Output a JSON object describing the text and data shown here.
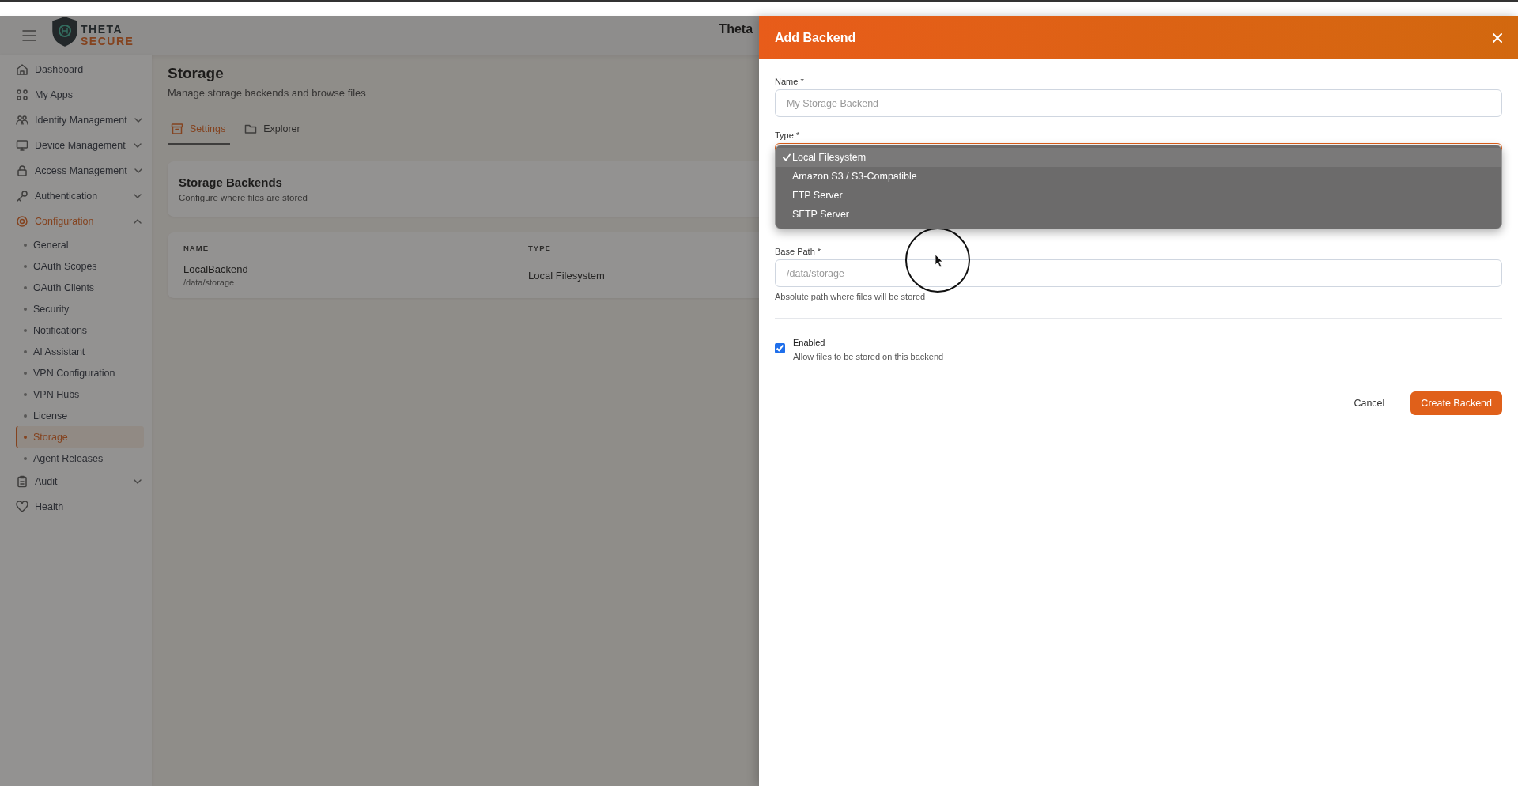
{
  "header": {
    "logo_lines": [
      "THETA",
      "SECURE"
    ],
    "title": "Theta"
  },
  "sidebar": {
    "items": [
      {
        "label": "Dashboard",
        "selected": false
      },
      {
        "label": "My Apps",
        "selected": false
      },
      {
        "label": "Identity Management",
        "selected": false,
        "expanded": false
      },
      {
        "label": "Device Management",
        "selected": false,
        "expanded": false
      },
      {
        "label": "Access Management",
        "selected": false,
        "expanded": false
      },
      {
        "label": "Authentication",
        "selected": false,
        "expanded": false
      },
      {
        "label": "Configuration",
        "selected": true,
        "expanded": true,
        "children": [
          {
            "label": "General",
            "selected": false
          },
          {
            "label": "OAuth Scopes",
            "selected": false
          },
          {
            "label": "OAuth Clients",
            "selected": false
          },
          {
            "label": "Security",
            "selected": false
          },
          {
            "label": "Notifications",
            "selected": false
          },
          {
            "label": "AI Assistant",
            "selected": false
          },
          {
            "label": "VPN Configuration",
            "selected": false
          },
          {
            "label": "VPN Hubs",
            "selected": false
          },
          {
            "label": "License",
            "selected": false
          },
          {
            "label": "Storage",
            "selected": true
          },
          {
            "label": "Agent Releases",
            "selected": false
          }
        ]
      },
      {
        "label": "Audit",
        "selected": false,
        "expanded": false
      },
      {
        "label": "Health",
        "selected": false
      }
    ]
  },
  "page": {
    "title": "Storage",
    "subtitle": "Manage storage backends and browse files",
    "tabs": [
      {
        "label": "Settings",
        "selected": true
      },
      {
        "label": "Explorer",
        "selected": false
      }
    ],
    "card": {
      "title": "Storage Backends",
      "subtitle": "Configure where files are stored"
    },
    "table": {
      "columns": [
        "NAME",
        "TYPE"
      ],
      "rows": [
        {
          "name": "LocalBackend",
          "path": "/data/storage",
          "type": "Local Filesystem"
        }
      ]
    }
  },
  "panel": {
    "title": "Add Backend",
    "name_field": {
      "label": "Name *",
      "placeholder": "My Storage Backend"
    },
    "type_field": {
      "label": "Type *",
      "options": [
        {
          "label": "Local Filesystem",
          "selected": true
        },
        {
          "label": "Amazon S3 / S3-Compatible",
          "selected": false
        },
        {
          "label": "FTP Server",
          "selected": false
        },
        {
          "label": "SFTP Server",
          "selected": false
        }
      ]
    },
    "base_path_field": {
      "label": "Base Path *",
      "placeholder": "/data/storage",
      "hint": "Absolute path where files will be stored"
    },
    "enabled": {
      "label": "Enabled",
      "description": "Allow files to be stored on this backend",
      "checked": true
    },
    "buttons": [
      {
        "label": "Cancel",
        "kind": "secondary"
      },
      {
        "label": "Create Backend",
        "kind": "primary"
      }
    ]
  }
}
